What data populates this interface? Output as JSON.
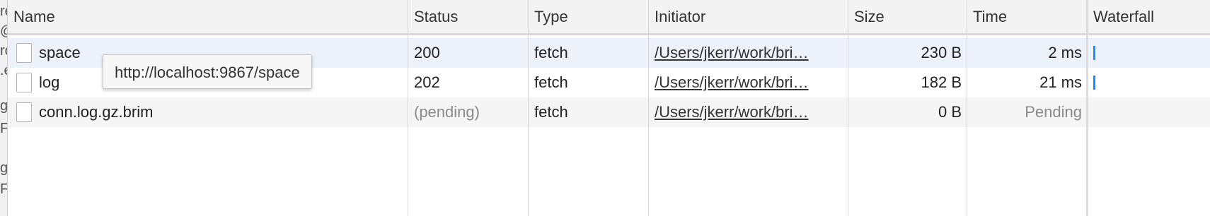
{
  "left_edge_fragments": [
    "re",
    "@",
    "ro",
    ".e",
    "gh",
    "F",
    "gh",
    "F"
  ],
  "columns": [
    {
      "key": "name",
      "label": "Name"
    },
    {
      "key": "status",
      "label": "Status"
    },
    {
      "key": "type",
      "label": "Type"
    },
    {
      "key": "initiator",
      "label": "Initiator"
    },
    {
      "key": "size",
      "label": "Size"
    },
    {
      "key": "time",
      "label": "Time"
    },
    {
      "key": "waterfall",
      "label": "Waterfall"
    }
  ],
  "rows": [
    {
      "name": "space",
      "status": "200",
      "type": "fetch",
      "initiator": "/Users/jkerr/work/bri…",
      "size": "230 B",
      "time": "2 ms",
      "selected": true,
      "waterfall_visible": true
    },
    {
      "name": "log",
      "status": "202",
      "type": "fetch",
      "initiator": "/Users/jkerr/work/bri…",
      "size": "182 B",
      "time": "21 ms",
      "selected": false,
      "waterfall_visible": true
    },
    {
      "name": "conn.log.gz.brim",
      "status": "(pending)",
      "type": "fetch",
      "initiator": "/Users/jkerr/work/bri…",
      "size": "0 B",
      "time": "Pending",
      "selected": false,
      "waterfall_visible": false
    }
  ],
  "tooltip": {
    "text": "http://localhost:9867/space"
  },
  "colors": {
    "header_bg": "#f3f3f3",
    "selected_row_bg": "#edf2fa",
    "alt_row_bg": "#f5f5f5",
    "waterfall_bar": "#1a8cff",
    "muted_text": "#8a8a8a"
  }
}
